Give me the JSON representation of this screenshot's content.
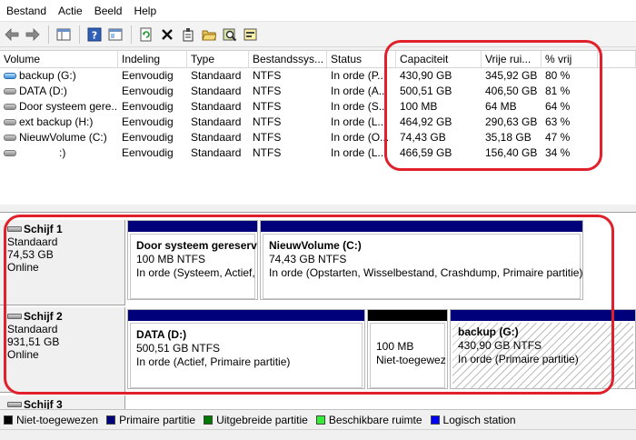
{
  "menu": [
    "Bestand",
    "Actie",
    "Beeld",
    "Help"
  ],
  "toolbar": {
    "buttons": [
      "back-arrow-icon",
      "forward-arrow-icon",
      "console-tree-icon",
      "help-icon",
      "properties-view-icon",
      "refresh-icon",
      "delete-icon",
      "properties-icon",
      "open-folder-icon",
      "search-icon",
      "export-icon"
    ]
  },
  "list": {
    "columns": [
      "Volume",
      "Indeling",
      "Type",
      "Bestandssys...",
      "Status",
      "Capaciteit",
      "Vrije rui...",
      "% vrij"
    ],
    "rows": [
      {
        "volume": "backup (G:)",
        "layout": "Eenvoudig",
        "type": "Standaard",
        "fs": "NTFS",
        "status": "In orde (P...",
        "capacity": "430,90 GB",
        "free": "345,92 GB",
        "pct": "80 %"
      },
      {
        "volume": "DATA (D:)",
        "layout": "Eenvoudig",
        "type": "Standaard",
        "fs": "NTFS",
        "status": "In orde (A...",
        "capacity": "500,51 GB",
        "free": "406,50 GB",
        "pct": "81 %"
      },
      {
        "volume": "Door systeem gere...",
        "layout": "Eenvoudig",
        "type": "Standaard",
        "fs": "NTFS",
        "status": "In orde (S...",
        "capacity": "100 MB",
        "free": "64 MB",
        "pct": "64 %"
      },
      {
        "volume": "ext backup (H:)",
        "layout": "Eenvoudig",
        "type": "Standaard",
        "fs": "NTFS",
        "status": "In orde (L...",
        "capacity": "464,92 GB",
        "free": "290,63 GB",
        "pct": "63 %"
      },
      {
        "volume": "NieuwVolume (C:)",
        "layout": "Eenvoudig",
        "type": "Standaard",
        "fs": "NTFS",
        "status": "In orde (O...",
        "capacity": "74,43 GB",
        "free": "35,18 GB",
        "pct": "47 %"
      },
      {
        "volume": ":)",
        "layout": "Eenvoudig",
        "type": "Standaard",
        "fs": "NTFS",
        "status": "In orde (L...",
        "capacity": "466,59 GB",
        "free": "156,40 GB",
        "pct": "34 %"
      }
    ]
  },
  "disks": [
    {
      "name": "Schijf 1",
      "type": "Standaard",
      "size": "74,53 GB",
      "state": "Online",
      "partitions": [
        {
          "name": "Door systeem gereserv",
          "size": "100 MB NTFS",
          "status": "In orde (Systeem, Actief,"
        },
        {
          "name": "NieuwVolume  (C:)",
          "size": "74,43 GB NTFS",
          "status": "In orde (Opstarten, Wisselbestand, Crashdump, Primaire partitie)"
        }
      ]
    },
    {
      "name": "Schijf 2",
      "type": "Standaard",
      "size": "931,51 GB",
      "state": "Online",
      "partitions": [
        {
          "name": "DATA  (D:)",
          "size": "500,51 GB NTFS",
          "status": "In orde (Actief, Primaire partitie)"
        },
        {
          "name": "",
          "size": "100 MB",
          "status": "Niet-toegewez"
        },
        {
          "name": "backup  (G:)",
          "size": "430,90 GB NTFS",
          "status": "In orde (Primaire partitie)"
        }
      ]
    },
    {
      "name": "Schijf 3"
    }
  ],
  "legend": [
    {
      "label": "Niet-toegewezen",
      "color": "#000000"
    },
    {
      "label": "Primaire partitie",
      "color": "#00007a"
    },
    {
      "label": "Uitgebreide partitie",
      "color": "#007a00"
    },
    {
      "label": "Beschikbare ruimte",
      "color": "#33ee33"
    },
    {
      "label": "Logisch station",
      "color": "#0000ff"
    }
  ],
  "colors": {
    "annotation": "#e0202a",
    "primary_partition": "#00007a",
    "unallocated": "#000000"
  }
}
